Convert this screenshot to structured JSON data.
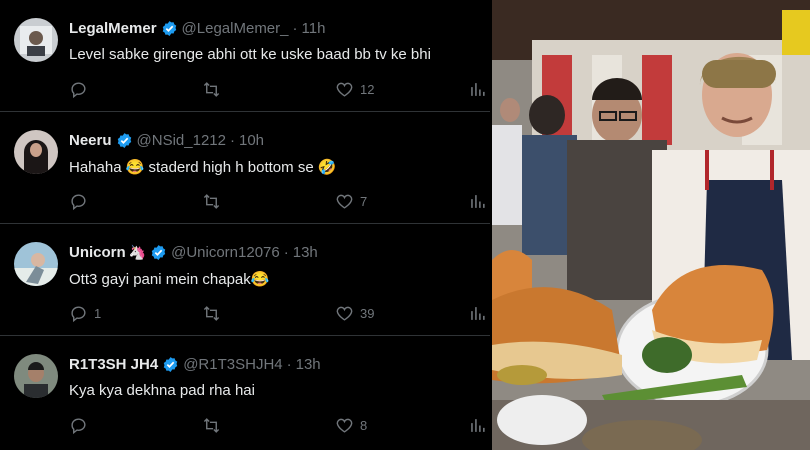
{
  "tweets": [
    {
      "name": "LegalMemer",
      "handle": "@LegalMemer_",
      "time": "11h",
      "text": "Level sabke girenge abhi ott ke uske baad bb tv ke bhi",
      "reply_count": "",
      "like_count": "12"
    },
    {
      "name": "Neeru",
      "handle": "@NSid_1212",
      "time": "10h",
      "text": "Hahaha 😂 staderd high h bottom se 🤣",
      "reply_count": "",
      "like_count": "7"
    },
    {
      "name": "Unicorn",
      "name_emoji": "🦄",
      "handle": "@Unicorn12076",
      "time": "13h",
      "text": "Ott3 gayi pani mein chapak😂",
      "reply_count": "1",
      "like_count": "39"
    },
    {
      "name": "R1T3SH JH4",
      "handle": "@R1T3SHJH4",
      "time": "13h",
      "text": "Kya kya dekhna pad rha hai",
      "reply_count": "",
      "like_count": "8"
    }
  ],
  "sep": "·",
  "icons": [
    "reply-icon",
    "retweet-icon",
    "like-icon",
    "views-icon",
    "verified-badge-icon"
  ],
  "colors": {
    "background": "#000000",
    "text": "#e7e9ea",
    "muted": "#71767b",
    "verified": "#1d9bf0"
  }
}
